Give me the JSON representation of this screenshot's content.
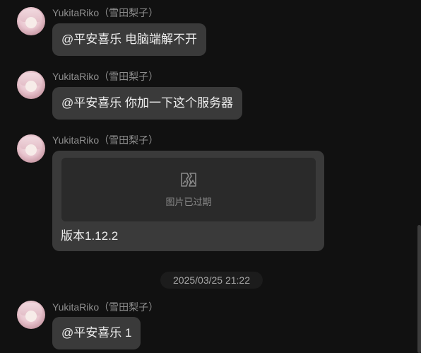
{
  "messages": [
    {
      "sender": "YukitaRiko（雪田梨子）",
      "text": "@平安喜乐 电脑端解不开"
    },
    {
      "sender": "YukitaRiko（雪田梨子）",
      "text": "@平安喜乐 你加一下这个服务器"
    },
    {
      "sender": "YukitaRiko（雪田梨子）",
      "image_expired_text": "图片已过期",
      "image_icon": "broken-image-icon",
      "caption": "版本1.12.2"
    },
    {
      "sender": "YukitaRiko（雪田梨子）",
      "text": "@平安喜乐 1"
    }
  ],
  "timestamp": "2025/03/25 21:22",
  "colors": {
    "background": "#111111",
    "bubble": "#3a3a3a",
    "sender_text": "#8e8e8e",
    "message_text": "#ededed"
  }
}
